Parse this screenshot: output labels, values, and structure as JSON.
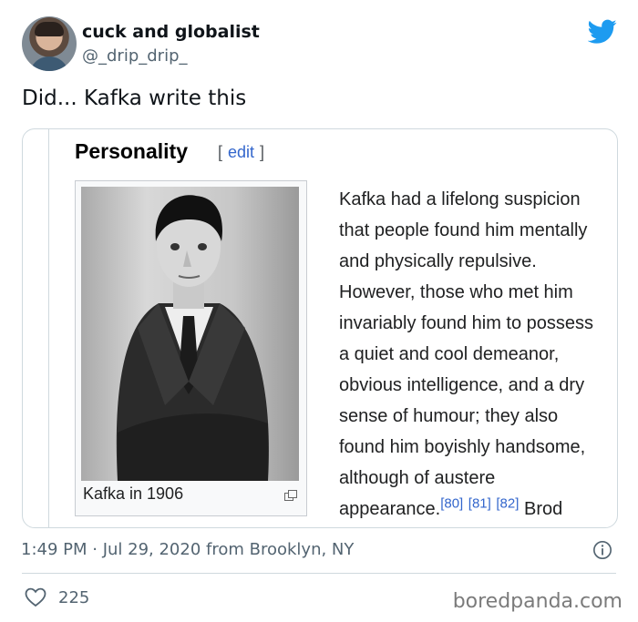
{
  "author": {
    "name": "cuck and globalist",
    "handle": "@_drip_drip_"
  },
  "tweet": {
    "text": "Did... Kafka write this"
  },
  "wiki": {
    "section_title": "Personality",
    "edit_bracket_open": "[",
    "edit_label": "edit",
    "edit_bracket_close": "]",
    "caption": "Kafka in 1906",
    "body_lines": [
      "Kafka had a lifelong suspicion",
      "that people found him mentally",
      "and physically repulsive.",
      "However, those who met him",
      "invariably found him to possess",
      "a quiet and cool demeanor,",
      "obvious intelligence, and a dry",
      "sense of humour; they also",
      "found him boyishly handsome,",
      "although of austere"
    ],
    "last_line_text": "appearance.",
    "refs": [
      "[80]",
      "[81]",
      "[82]"
    ],
    "trailing_word": "Brod"
  },
  "meta": {
    "timestamp": "1:49 PM · Jul 29, 2020 from Brooklyn, NY"
  },
  "engagement": {
    "likes": "225"
  },
  "watermark": "boredpanda.com",
  "colors": {
    "twitter_blue": "#1d9bf0",
    "wiki_link": "#3366cc",
    "secondary_text": "#536471"
  }
}
